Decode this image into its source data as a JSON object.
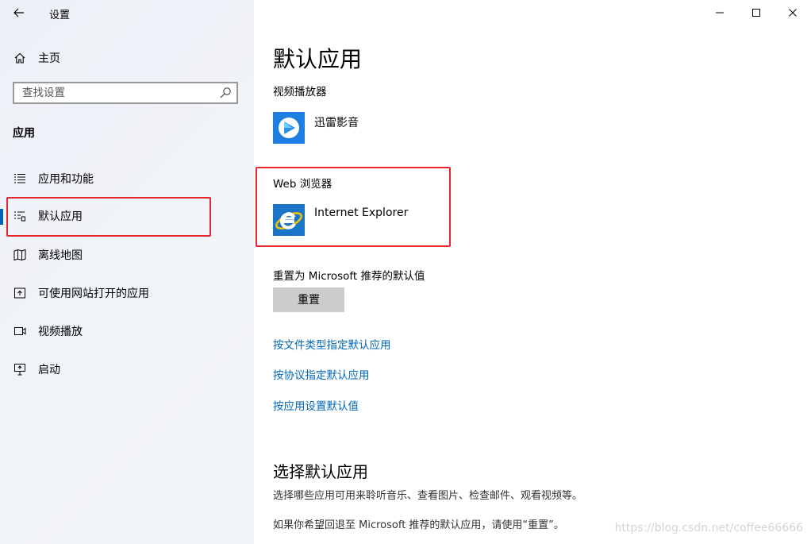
{
  "window": {
    "title": "设置",
    "controls": [
      "minimize",
      "maximize",
      "close"
    ]
  },
  "sidebar": {
    "home_label": "主页",
    "search_placeholder": "查找设置",
    "section_title": "应用",
    "items": [
      {
        "label": "应用和功能",
        "icon": "apps-features-icon"
      },
      {
        "label": "默认应用",
        "icon": "default-apps-icon",
        "selected": true
      },
      {
        "label": "离线地图",
        "icon": "offline-maps-icon"
      },
      {
        "label": "可使用网站打开的应用",
        "icon": "apps-for-websites-icon"
      },
      {
        "label": "视频播放",
        "icon": "video-playback-icon"
      },
      {
        "label": "启动",
        "icon": "startup-icon"
      }
    ]
  },
  "main": {
    "title": "默认应用",
    "video_player": {
      "heading": "视频播放器",
      "app_name": "迅雷影音"
    },
    "web_browser": {
      "heading": "Web 浏览器",
      "app_name": "Internet Explorer"
    },
    "reset": {
      "description": "重置为 Microsoft 推荐的默认值",
      "button_label": "重置"
    },
    "links": [
      "按文件类型指定默认应用",
      "按协议指定默认应用",
      "按应用设置默认值"
    ],
    "choose_section": {
      "heading": "选择默认应用",
      "text1": "选择哪些应用可用来聆听音乐、查看图片、检查邮件、观看视频等。",
      "text2": "如果你希望回退至 Microsoft 推荐的默认应用，请使用“重置”。"
    }
  },
  "watermark": "https://blog.csdn.net/coffee66666",
  "colors": {
    "accent": "#0063b1",
    "link": "#0067b8",
    "highlight_box": "#e8262b",
    "button_bg": "#cccccc"
  }
}
